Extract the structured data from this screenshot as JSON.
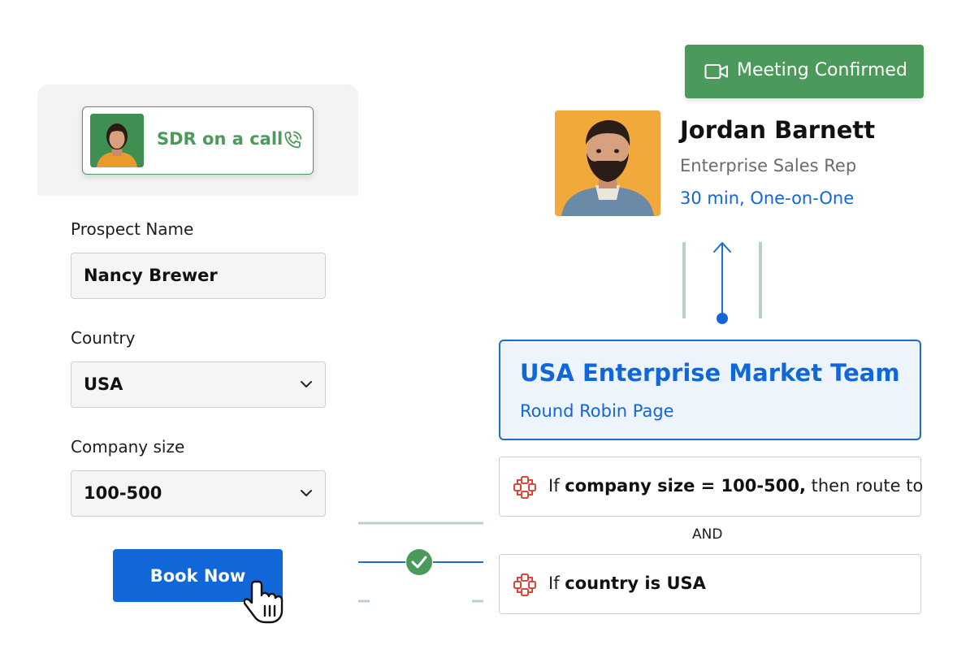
{
  "sdr_status": {
    "label": "SDR on a call",
    "avatar_icon": "person-avatar",
    "call_icon": "phone-ringing-icon",
    "accent_color": "#4c9a5b"
  },
  "form": {
    "prospect_name_label": "Prospect Name",
    "prospect_name_value": "Nancy Brewer",
    "country_label": "Country",
    "country_value": "USA",
    "company_size_label": "Company size",
    "company_size_value": "100-500",
    "book_button": "Book Now"
  },
  "meeting": {
    "status_label": "Meeting Confirmed",
    "status_icon": "video-camera-icon",
    "status_color": "#4c9a5b"
  },
  "rep": {
    "name": "Jordan Barnett",
    "title": "Enterprise Sales Rep",
    "duration": "30 min, One-on-One"
  },
  "team": {
    "title": "USA Enterprise Market Team",
    "subtitle": "Round Robin Page",
    "accent_color": "#1166d8"
  },
  "rules": {
    "rule1_prefix": "If ",
    "rule1_bold": "company size = 100-500,",
    "rule1_suffix": " then route to",
    "joiner": "AND",
    "rule2_prefix": "If ",
    "rule2_bold": "country is USA",
    "rule_icon": "routing-nodes-icon",
    "rule_icon_color": "#d9473a"
  }
}
